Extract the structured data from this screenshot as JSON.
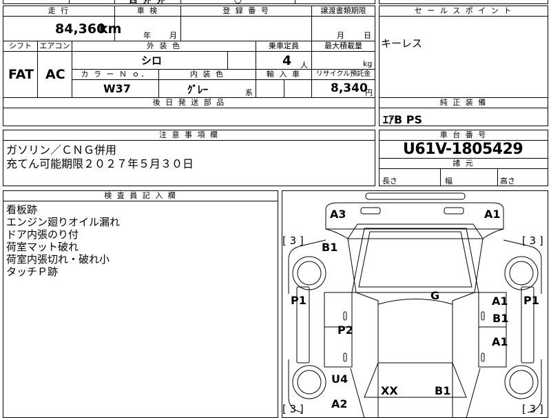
{
  "top_fragments": {
    "a": "四",
    "b": "外",
    "c": "外",
    "d": "〇"
  },
  "mileage": {
    "header": "走 行",
    "value": "84,360",
    "unit": "km"
  },
  "inspection": {
    "header": "車 検",
    "year_label": "年",
    "month_label": "月"
  },
  "registration": {
    "header": "登 録 番 号"
  },
  "transfer": {
    "header": "譲渡書類期限",
    "month_label": "月",
    "day_label": "日"
  },
  "sales_point": {
    "header": "セ ー ル ス ポ イ ン ト",
    "text": "キーレス"
  },
  "shift": {
    "header": "シフト",
    "value": "FAT"
  },
  "aircon": {
    "header": "エアコン",
    "value": "AC"
  },
  "exterior_color": {
    "header": "外 装 色",
    "value": "シロ"
  },
  "capacity": {
    "header": "乗車定員",
    "value": "4",
    "unit": "人"
  },
  "max_load": {
    "header": "最大積載量",
    "unit": "kg"
  },
  "color_no": {
    "header": "カ ラ ー Ｎ ｏ．",
    "value": "W37"
  },
  "interior_color": {
    "header": "内 装 色",
    "value": "ｸﾞﾚｰ",
    "suffix": "系"
  },
  "import": {
    "header": "輸 入 車"
  },
  "recycle": {
    "header": "リサイクル預託金",
    "value": "8,340",
    "unit": "円"
  },
  "later_parts": {
    "header": "後 日 発 送 部 品"
  },
  "genuine_equipment": {
    "header": "純 正 装 備",
    "text": "ｴｱB PS"
  },
  "caution": {
    "header": "注 意 事 項 欄",
    "lines": [
      "ガソリン／ＣＮＧ併用",
      "充てん可能期限２０２７年５月３０日"
    ]
  },
  "chassis": {
    "header": "車 台 番 号",
    "value": "U61V-1805429"
  },
  "dimensions": {
    "header": "諸 元",
    "length": "長さ",
    "width": "幅",
    "height": "高さ"
  },
  "inspector": {
    "header": "検 査 員 記 入 欄",
    "lines": [
      "看板跡",
      "エンジン廻りオイル漏れ",
      "ドア内張のり付",
      "荷室マット破れ",
      "荷室内張切れ・破れ小",
      "タッチＰ跡"
    ]
  },
  "diagram": {
    "tires": {
      "fl": "[ 3 ]",
      "fr": "[ 3 ]",
      "rl": "[ 3 ]",
      "rr": "[ 3 ]"
    },
    "marks": {
      "front_left_corner": "A3",
      "front_right_corner": "A1",
      "hood_left": "B1",
      "left_outer": "P1",
      "left_p2": "P2",
      "roof": "G",
      "right_door_front": "A1",
      "right_door_mid": "B1",
      "right_door_rear": "A1",
      "right_outer": "P1",
      "left_rear": "U4",
      "rear_left_corner": "A2",
      "tail_left": "XX",
      "tail_right": "B1"
    }
  }
}
